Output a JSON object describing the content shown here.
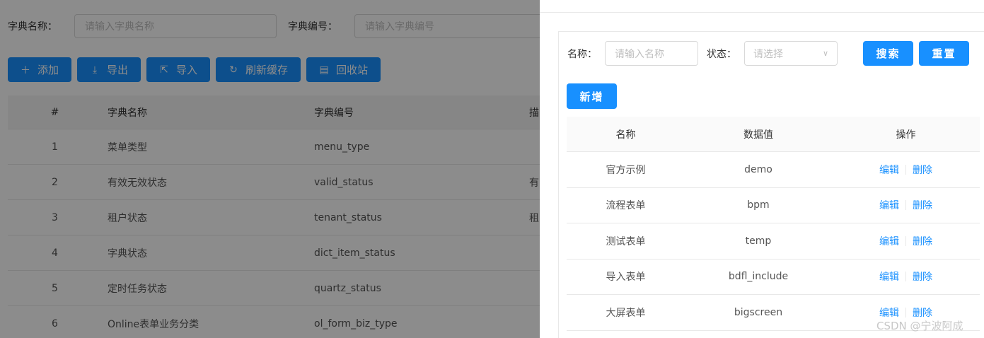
{
  "background": {
    "search": {
      "name_label": "字典名称：",
      "name_placeholder": "请输入字典名称",
      "code_label": "字典编号：",
      "code_placeholder": "请输入字典编号"
    },
    "toolbar": {
      "add": "添加",
      "export": "导出",
      "import": "导入",
      "refresh": "刷新缓存",
      "recycle": "回收站"
    },
    "table": {
      "headers": [
        "#",
        "字典名称",
        "字典编号",
        "描"
      ],
      "rows": [
        {
          "idx": "1",
          "name": "菜单类型",
          "code": "menu_type",
          "extra": ""
        },
        {
          "idx": "2",
          "name": "有效无效状态",
          "code": "valid_status",
          "extra": "有"
        },
        {
          "idx": "3",
          "name": "租户状态",
          "code": "tenant_status",
          "extra": "租"
        },
        {
          "idx": "4",
          "name": "字典状态",
          "code": "dict_item_status",
          "extra": ""
        },
        {
          "idx": "5",
          "name": "定时任务状态",
          "code": "quartz_status",
          "extra": ""
        },
        {
          "idx": "6",
          "name": "Online表单业务分类",
          "code": "ol_form_biz_type",
          "extra": ""
        }
      ]
    }
  },
  "drawer": {
    "search": {
      "name_label": "名称：",
      "name_placeholder": "请输入名称",
      "status_label": "状态：",
      "status_placeholder": "请选择",
      "search_button": "搜索",
      "reset_button": "重置"
    },
    "add_button": "新增",
    "table": {
      "headers": [
        "名称",
        "数据值",
        "操作"
      ],
      "rows": [
        {
          "name": "官方示例",
          "value": "demo"
        },
        {
          "name": "流程表单",
          "value": "bpm"
        },
        {
          "name": "测试表单",
          "value": "temp"
        },
        {
          "name": "导入表单",
          "value": "bdfl_include"
        },
        {
          "name": "大屏表单",
          "value": "bigscreen"
        }
      ],
      "edit_label": "编辑",
      "delete_label": "删除"
    }
  },
  "watermark": "CSDN @宁波阿成",
  "colors": {
    "primary": "#1890ff",
    "mask": "rgba(0,0,0,0.45)"
  }
}
